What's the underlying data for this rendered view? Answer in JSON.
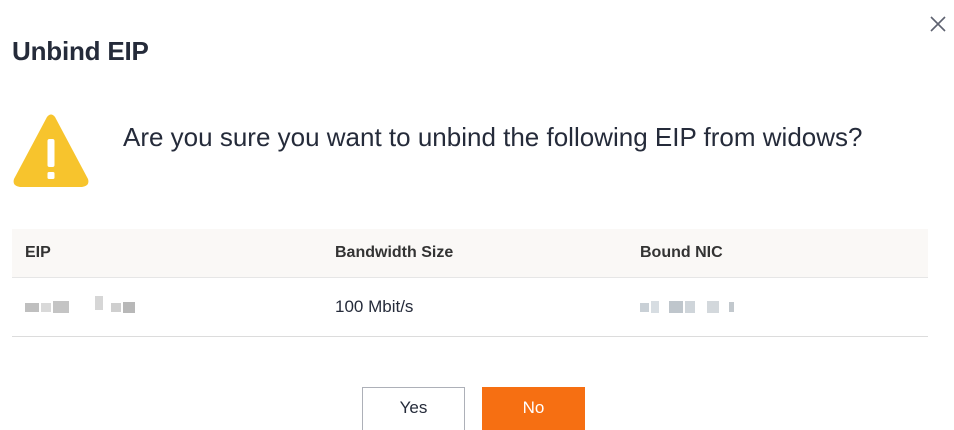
{
  "dialog": {
    "title": "Unbind EIP",
    "close_icon": "close-icon",
    "message": "Are you sure you want to unbind the following EIP from widows?",
    "warning_icon": "warning-triangle-icon",
    "warning_color": "#f7c42d"
  },
  "table": {
    "columns": [
      "EIP",
      "Bandwidth Size",
      "Bound NIC"
    ],
    "rows": [
      {
        "eip": "",
        "bandwidth": "100 Mbit/s",
        "nic": ""
      }
    ]
  },
  "actions": {
    "yes_label": "Yes",
    "no_label": "No",
    "primary_color": "#f66f12"
  }
}
